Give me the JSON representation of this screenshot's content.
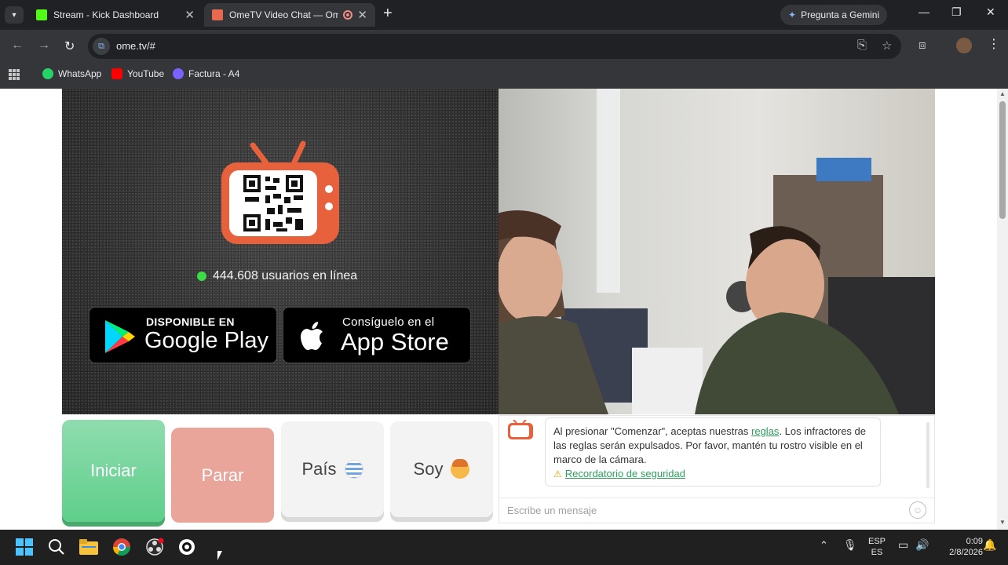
{
  "browser": {
    "tabs": [
      {
        "title": "Stream - Kick Dashboard",
        "active": false,
        "favicon_color": "#53fc18"
      },
      {
        "title": "OmeTV Video Chat — Ome",
        "active": true,
        "favicon_color": "#e86a4e"
      }
    ],
    "gemini_label": "Pregunta a Gemini",
    "url": "ome.tv/#",
    "bookmarks": [
      {
        "label": "WhatsApp",
        "icon": "whatsapp-icon",
        "color": "#25d366"
      },
      {
        "label": "YouTube",
        "icon": "youtube-icon",
        "color": "#ff0000"
      },
      {
        "label": "Factura - A4",
        "icon": "factura-icon",
        "color": "#7b61ff"
      }
    ]
  },
  "page": {
    "online_text": "444.608 usuarios en línea",
    "google_play": {
      "small": "DISPONIBLE EN",
      "big": "Google Play"
    },
    "app_store": {
      "small": "Consíguelo en el",
      "big": "App Store"
    },
    "buttons": {
      "start": "Iniciar",
      "stop": "Parar",
      "country": "País",
      "gender": "Soy"
    },
    "chat": {
      "message_part1": "Al presionar \"Comenzar\", aceptas nuestras ",
      "rules_link": "reglas",
      "message_part2": ". Los infractores de las reglas serán expulsados. Por favor, mantén tu rostro visible en el marco de la cámara.",
      "safety_link": "Recordatorio de seguridad",
      "input_placeholder": "Escribe un mensaje"
    }
  },
  "taskbar": {
    "lang_top": "ESP",
    "lang_bottom": "ES",
    "time": "0:09",
    "date": "2/8/2026"
  },
  "colors": {
    "accent_green": "#5fcf8b",
    "stop_salmon": "#eaa59a",
    "ome_orange": "#e86a4e",
    "link_green": "#2e9e5c"
  }
}
